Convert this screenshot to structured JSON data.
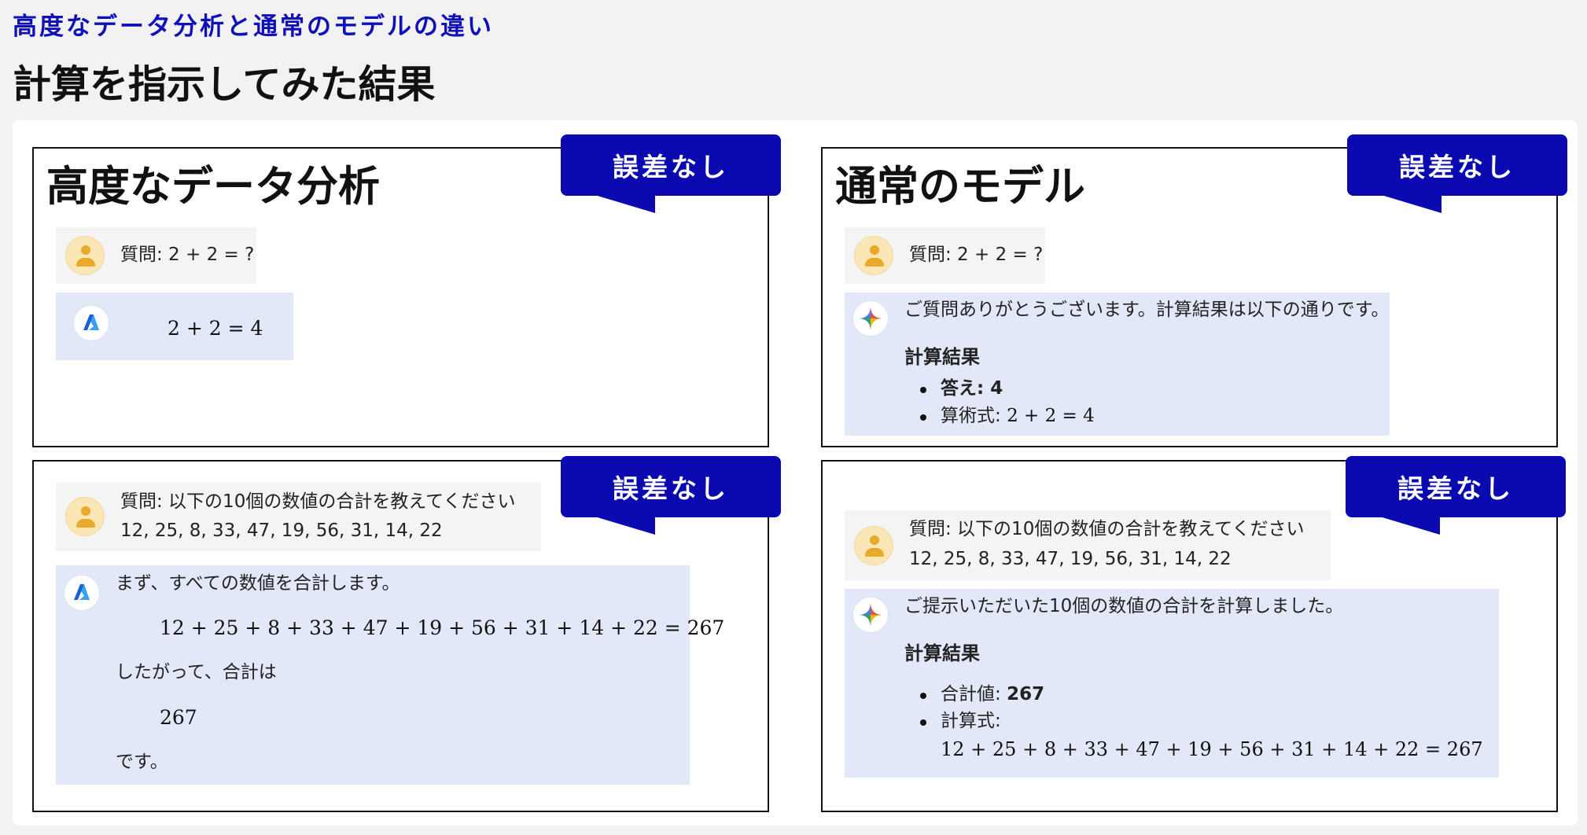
{
  "header": {
    "subtitle": "高度なデータ分析と通常のモデルの違い",
    "title": "計算を指示してみた結果"
  },
  "panels": {
    "tl": {
      "title": "高度なデータ分析",
      "badge": "誤差なし",
      "question": "質問: 2 + 2 = ?",
      "answer_math": "2 + 2 = 4"
    },
    "tr": {
      "title": "通常のモデル",
      "badge": "誤差なし",
      "question": "質問: 2 + 2 = ?",
      "answer_intro": "ご質問ありがとうございます。計算結果は以下の通りです。",
      "result_heading": "計算結果",
      "bullet1_label": "答え: ",
      "bullet1_value": "4",
      "bullet2_label": "算術式: ",
      "bullet2_math": "2 + 2 = 4"
    },
    "bl": {
      "badge": "誤差なし",
      "question_line1": "質問: 以下の10個の数値の合計を教えてください",
      "question_line2": "12, 25, 8, 33, 47, 19, 56, 31, 14, 22",
      "answer_intro": "まず、すべての数値を合計します。",
      "answer_math": "12 + 25 + 8 + 33 + 47 + 19 + 56 + 31 + 14 + 22 = 267",
      "answer_mid": "したがって、合計は",
      "answer_value": "267",
      "answer_end": "です。"
    },
    "br": {
      "badge": "誤差なし",
      "question_line1": "質問: 以下の10個の数値の合計を教えてください",
      "question_line2": "12, 25, 8, 33, 47, 19, 56, 31, 14, 22",
      "answer_intro": "ご提示いただいた10個の数値の合計を計算しました。",
      "result_heading": "計算結果",
      "bullet1_label": "合計値: ",
      "bullet1_value": "267",
      "bullet2_label": "計算式:",
      "bullet2_math": "12 + 25 + 8 + 33 + 47 + 19 + 56 + 31 + 14 + 22 = 267"
    }
  },
  "colors": {
    "accent": "#0a0ab0",
    "subtitle": "#1010b8",
    "answer_bg": "#e3e8f8",
    "question_bg": "#f4f4f4",
    "avatar": "#fbe6b5"
  },
  "icons": {
    "user": "user-avatar-icon",
    "azure": "azure-logo-icon",
    "gemini": "sparkle-logo-icon"
  }
}
